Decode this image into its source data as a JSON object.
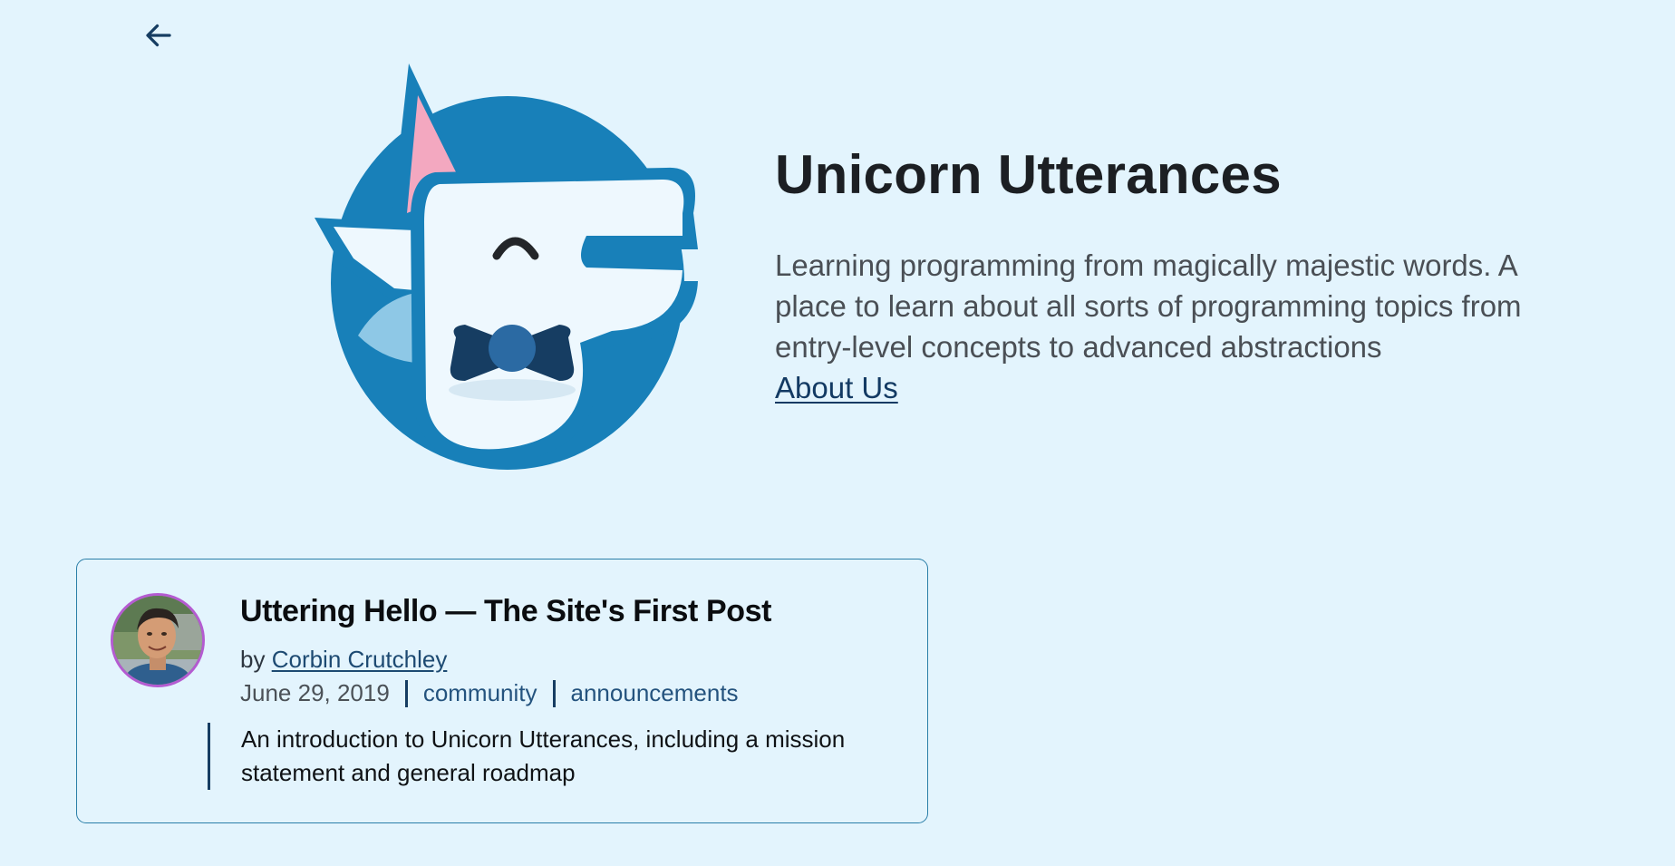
{
  "nav": {
    "back_icon": "arrow-left-icon"
  },
  "hero": {
    "logo_icon": "unicorn-logo-icon",
    "title": "Unicorn Utterances",
    "description": "Learning programming from magically majestic words. A place to learn about all sorts of programming topics from entry-level concepts to advanced abstractions",
    "about_link": "About Us"
  },
  "posts": [
    {
      "title": "Uttering Hello — The Site's First Post",
      "byline_prefix": "by",
      "author": "Corbin Crutchley",
      "date": "June 29, 2019",
      "tags": [
        "community",
        "announcements"
      ],
      "excerpt": "An introduction to Unicorn Utterances, including a mission statement and general roadmap",
      "avatar_icon": "author-avatar"
    }
  ],
  "colors": {
    "background": "#e3f4fd",
    "brand_blue": "#1880b9",
    "navy": "#163d62",
    "avatar_border": "#b45bd1",
    "card_border": "#2a7ea8"
  }
}
